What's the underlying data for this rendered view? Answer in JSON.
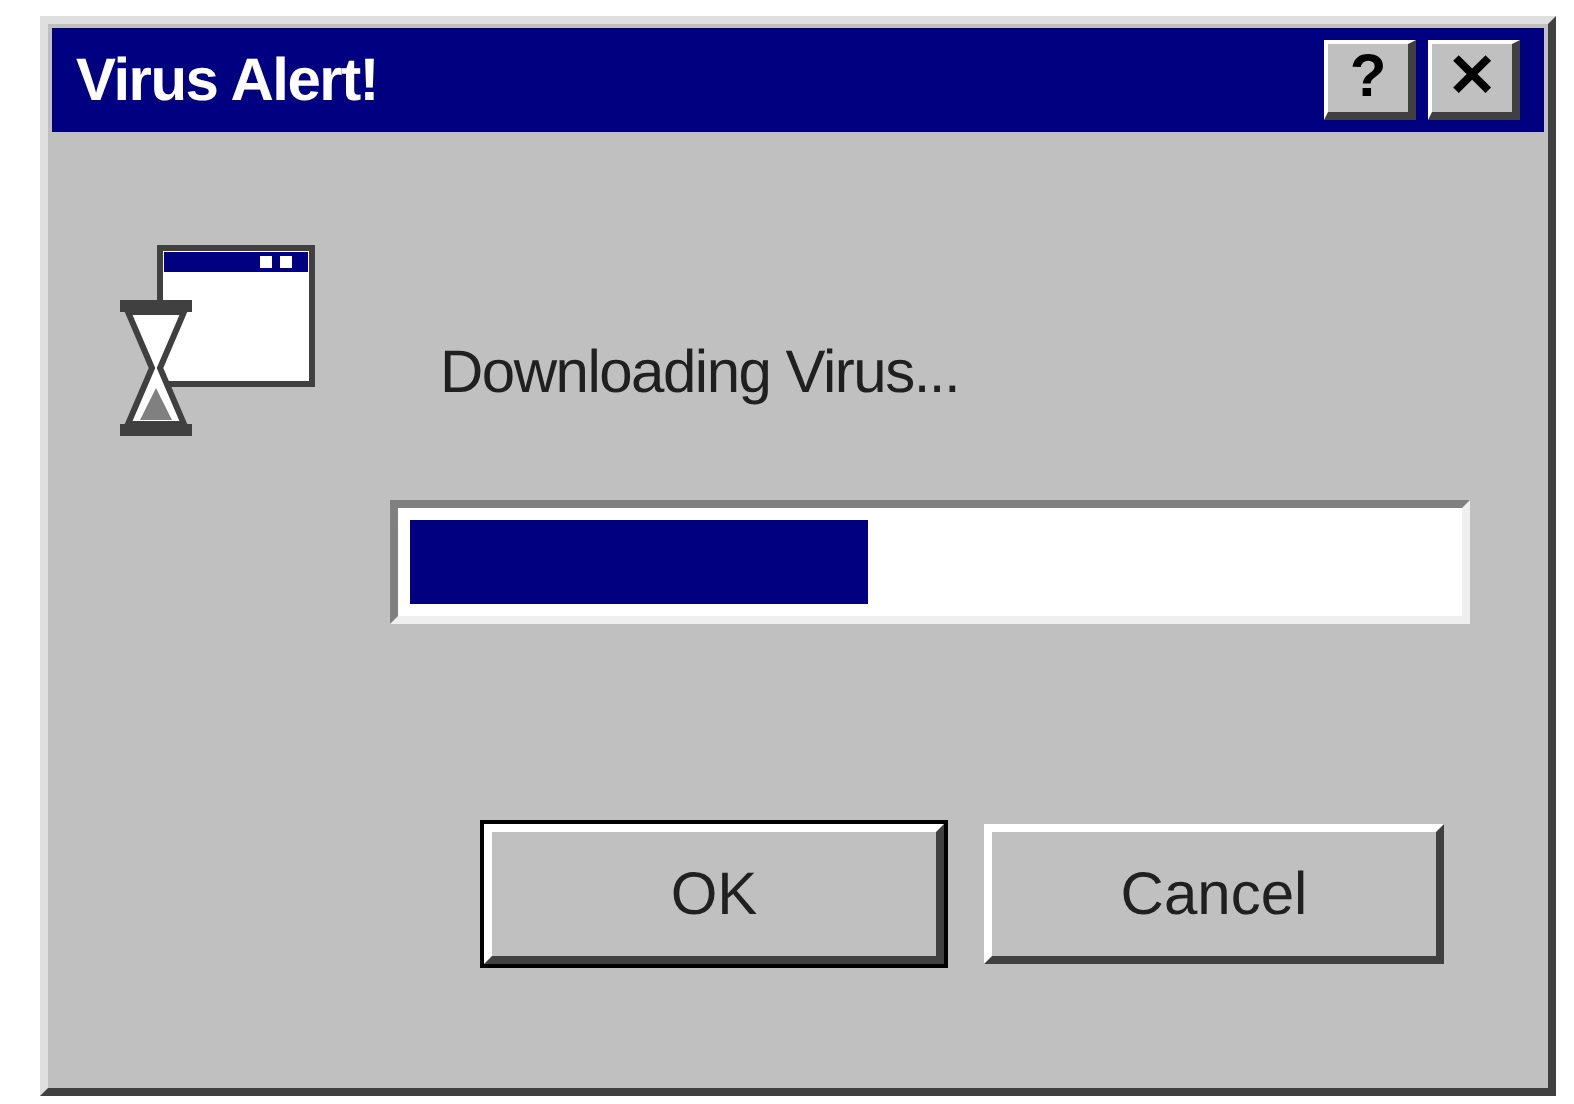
{
  "window": {
    "title": "Virus Alert!",
    "title_buttons": [
      "?",
      "✕"
    ]
  },
  "message": "Downloading Virus...",
  "progress": {
    "level": 0.44
  },
  "buttons": [
    {
      "label": "OK",
      "default": true
    },
    {
      "label": "Cancel",
      "default": false
    }
  ]
}
